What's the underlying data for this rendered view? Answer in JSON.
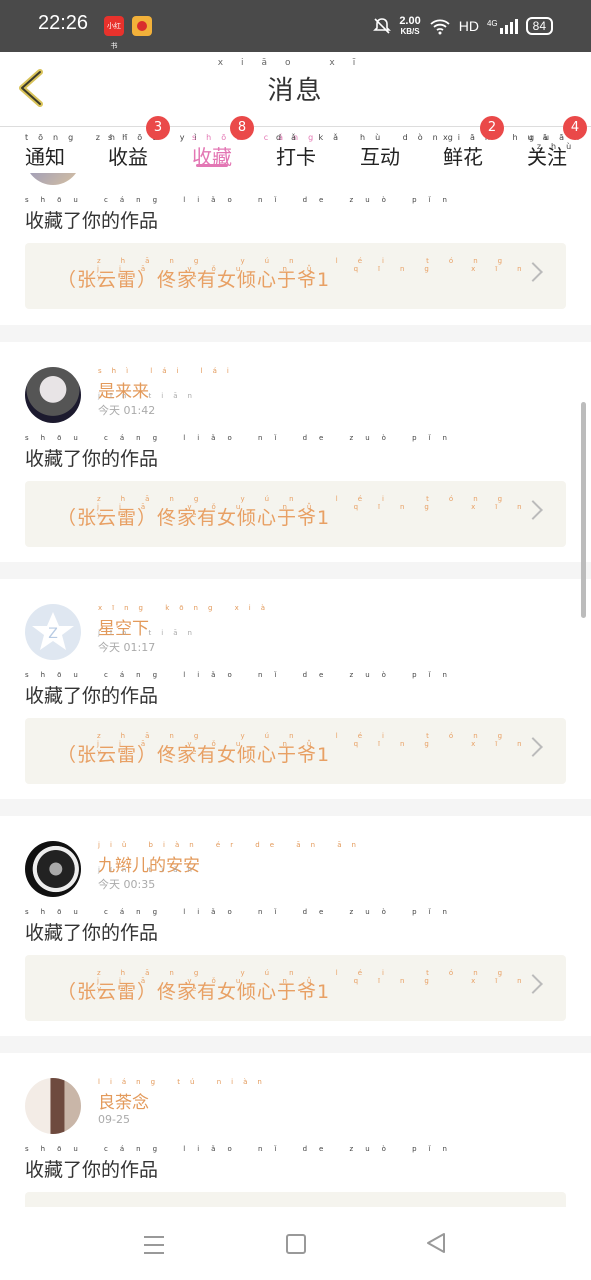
{
  "status_bar": {
    "time": "22:26",
    "app1": "小红书",
    "speed_value": "2.00",
    "speed_unit": "KB/S",
    "network": "HD",
    "signal": "4G",
    "battery": "84"
  },
  "header": {
    "title": "消息",
    "title_pinyin": "xiāo xī"
  },
  "tabs": [
    {
      "label": "通知",
      "pinyin": "tōng zhī",
      "badge": ""
    },
    {
      "label": "收益",
      "pinyin": "shōu yì",
      "badge": "3"
    },
    {
      "label": "收藏",
      "pinyin": "shōu cáng",
      "badge": "8",
      "active": true
    },
    {
      "label": "打卡",
      "pinyin": "dǎ kǎ",
      "badge": ""
    },
    {
      "label": "互动",
      "pinyin": "hù dòng",
      "badge": ""
    },
    {
      "label": "鲜花",
      "pinyin": "xiān huā",
      "badge": "2"
    },
    {
      "label": "关注",
      "pinyin": "guān zhù",
      "badge": "4"
    }
  ],
  "messages": [
    {
      "name": "",
      "time": "",
      "action": "收藏了你的作品",
      "work": "（张云雷）佟家有女倾心于爷1"
    },
    {
      "name": "是来来",
      "time": "今天 01:42",
      "action": "收藏了你的作品",
      "work": "（张云雷）佟家有女倾心于爷1"
    },
    {
      "name": "星空下",
      "time": "今天 01:17",
      "action": "收藏了你的作品",
      "work": "（张云雷）佟家有女倾心于爷1"
    },
    {
      "name": "九辫儿的安安",
      "time": "今天 00:35",
      "action": "收藏了你的作品",
      "work": "（张云雷）佟家有女倾心于爷1"
    },
    {
      "name": "良荼念",
      "time": "09-25",
      "action": "收藏了你的作品",
      "work": ""
    }
  ],
  "pinyin": {
    "action": "shōu cáng liǎo nǐ de zuò pǐn",
    "work": "zhāng yún léi tóng jiā yǒu nǚ qīng xīn yú yé",
    "n1": "shì lái lái",
    "n2": "xīng kōng xià",
    "n3": "jiǔ biàn ér de ān ān",
    "n4": "liáng tú niàn",
    "today": "jīn tiān"
  },
  "colors": {
    "accent": "#e377b4",
    "name": "#e39a5b",
    "badge": "#ea4949"
  }
}
